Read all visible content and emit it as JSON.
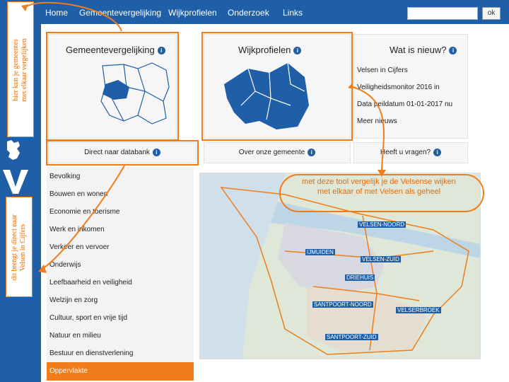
{
  "nav": {
    "items": [
      "Home",
      "Gemeentevergelijking",
      "Wijkprofielen",
      "Onderzoek",
      "Links"
    ],
    "search_placeholder": "",
    "ok_label": "ok"
  },
  "panels": {
    "gemeentevergelijking": "Gemeentevergelijking",
    "wijkprofielen": "Wijkprofielen",
    "wat_is_nieuw": "Wat is nieuw?"
  },
  "news": [
    "Velsen in Cijfers",
    "Veiligheidsmonitor 2016 in",
    "Data peildatum 01-01-2017 nu",
    "Meer nieuws"
  ],
  "bars": {
    "direct": "Direct naar databank",
    "over": "Over onze gemeente",
    "vragen": "Heeft u vragen?"
  },
  "menu": [
    "Bevolking",
    "Bouwen en wonen",
    "Economie en toerisme",
    "Werk en inkomen",
    "Verkeer en vervoer",
    "Onderwijs",
    "Leefbaarheid en veiligheid",
    "Welzijn en zorg",
    "Cultuur, sport en vrije tijd",
    "Natuur en milieu",
    "Bestuur en dienstverlening"
  ],
  "menu_active": "Oppervlakte",
  "annotations": {
    "top_label": [
      "hier kun je gemeentes",
      "met elkaar vergelijken"
    ],
    "left_label": [
      "dit brengt je direct naar",
      "Velsen in Cijfers"
    ],
    "map_callout": "met deze tool vergelijk je de Velsense wijken met elkaar of met Velsen als geheel"
  },
  "map_labels": [
    "VELSEN-NOORD",
    "IJMUIDEN",
    "VELSEN-ZUID",
    "DRIEHUIS",
    "SANTPOORT-NOORD",
    "VELSERBROEK",
    "SANTPOORT-ZUID"
  ],
  "colors": {
    "brand_blue": "#1f5fa8",
    "accent_orange": "#f07d1a"
  }
}
